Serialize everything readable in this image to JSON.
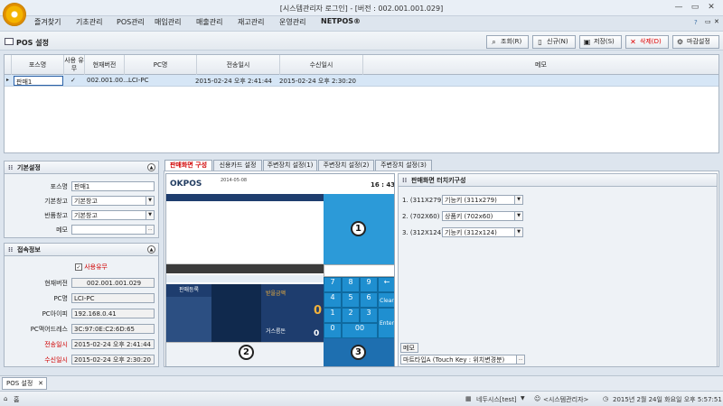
{
  "window": {
    "title": "[시스템관리자 로그인] - [버전 : 002.001.001.029]"
  },
  "menu": [
    "즐겨찾기",
    "기초관리",
    "POS관리",
    "매입관리",
    "매출관리",
    "재고관리",
    "운영관리",
    "NETPOS®"
  ],
  "page": {
    "title": "POS 설정"
  },
  "toolbar": {
    "search": "조회(R)",
    "new": "신규(N)",
    "save": "저장(S)",
    "delete": "삭제(D)",
    "close": "마감설정"
  },
  "grid": {
    "headers": [
      "포스명",
      "사용 유무",
      "현재버전",
      "PC명",
      "전송일시",
      "수신일시",
      "메모"
    ],
    "rows": [
      [
        "판매1",
        "✓",
        "002.001.00...",
        "LCI-PC",
        "2015-02-24 오후 2:41:44",
        "2015-02-24 오후 2:30:20",
        ""
      ]
    ]
  },
  "basic": {
    "title": "기본설정",
    "labels": [
      "포스명",
      "기본창고",
      "반품창고",
      "메모"
    ],
    "values": [
      "판매1",
      "기본창고",
      "기본창고",
      ""
    ]
  },
  "conn": {
    "title": "접속정보",
    "use_label": "사용유무",
    "labels": [
      "현재버전",
      "PC명",
      "PC아이피",
      "PC맥어드레스",
      "전송일시",
      "수신일시"
    ],
    "values": [
      "002.001.001.029",
      "LCI-PC",
      "192.168.0.41",
      "3C:97:0E:C2:6D:65",
      "2015-02-24 오후 2:41:44",
      "2015-02-24 오후 2:30:20"
    ]
  },
  "tabs": [
    "판매화면 구성",
    "신용카드 설정",
    "주변장치 설정(1)",
    "주변장치 설정(2)",
    "주변장치 설정(3)"
  ],
  "touch": {
    "title": "판매화면 터치키구성",
    "rows": [
      {
        "label": "1. (311X279)",
        "value": "기능키 (311x279)"
      },
      {
        "label": "2. (702X60)",
        "value": "상품키 (702x60)"
      },
      {
        "label": "3. (312X124)",
        "value": "기능키 (312x124)"
      }
    ],
    "memo_label": "메모",
    "memo_value": "마트타입A (Touch Key : 위치변경분)"
  },
  "preview": {
    "brand": "OKPOS",
    "date": "2014-05-08",
    "time": "16 : 43",
    "sale_reg": "판매등록",
    "price_label": "받을금액",
    "change_label": "거스름돈",
    "zero": "0",
    "clear": "Clear",
    "enter": "Enter",
    "badges": [
      "1",
      "2",
      "3"
    ]
  },
  "bottomtab": "POS 설정",
  "status": {
    "home": "홈",
    "store": "네두시스[test]",
    "user": "<시스템관리자>",
    "datetime": "2015년 2월 24일 화요일 오후 5:57:51"
  }
}
